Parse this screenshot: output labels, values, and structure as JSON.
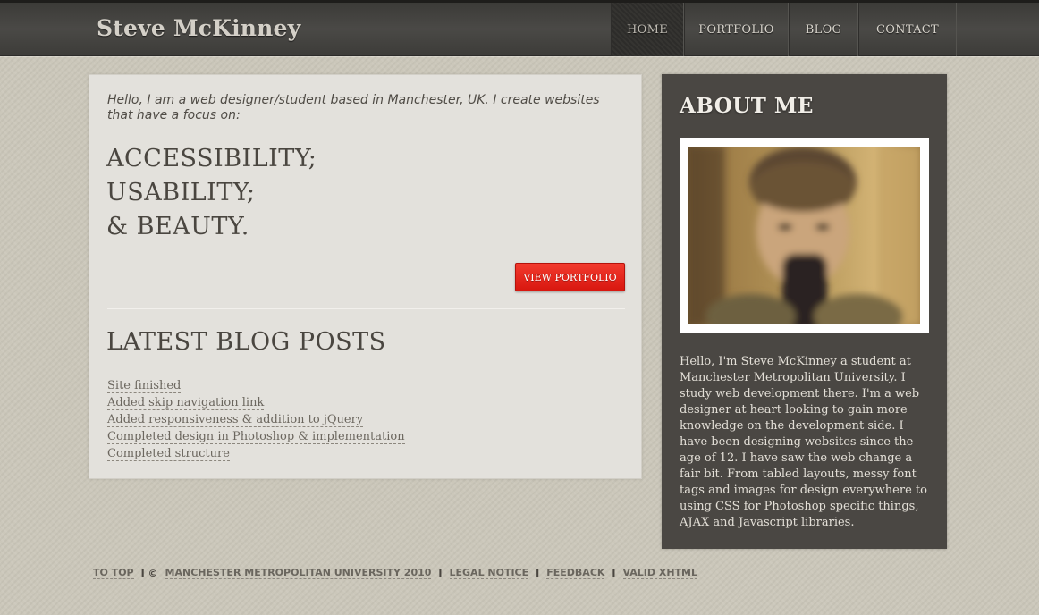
{
  "header": {
    "logo": "Steve McKinney",
    "nav": [
      {
        "label": "HOME",
        "active": true
      },
      {
        "label": "PORTFOLIO",
        "active": false
      },
      {
        "label": "BLOG",
        "active": false
      },
      {
        "label": "CONTACT",
        "active": false
      }
    ]
  },
  "main": {
    "intro": "Hello, I am a web designer/student based in Manchester, UK. I create websites that have a focus on:",
    "focus": [
      "ACCESSIBILITY;",
      "USABILITY;",
      "& BEAUTY."
    ],
    "view_portfolio_label": "VIEW PORTFOLIO",
    "blog_title": "LATEST BLOG POSTS",
    "blog_posts": [
      "Site finished",
      "Added skip navigation link",
      "Added responsiveness & addition to jQuery",
      "Completed design in Photoshop & implementation",
      "Completed structure"
    ]
  },
  "sidebar": {
    "title": "ABOUT ME",
    "bio": "Hello, I'm Steve McKinney a student at Manchester Metropolitan University. I study web development there. I'm a web designer at heart looking to gain more knowledge on the development side. I have been designing websites since the age of 12. I have saw the web change a fair bit. From tabled layouts, messy font tags and images for design everywhere to using CSS for Photoshop specific things, AJAX and Javascript libraries."
  },
  "footer": {
    "to_top": "TO TOP",
    "sep1": "I ©",
    "university": "MANCHESTER METROPOLITAN UNIVERSITY 2010",
    "legal": "LEGAL NOTICE",
    "feedback": "FEEDBACK",
    "valid": "VALID XHTML",
    "divider": "I"
  },
  "colors": {
    "accent_red": "#e4231a",
    "header_dark": "#42413e",
    "sidebar_bg": "#4a4743",
    "page_bg": "#cbc7ba"
  }
}
